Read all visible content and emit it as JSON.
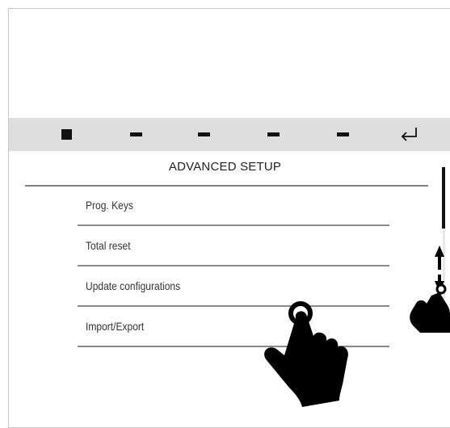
{
  "toolbar": {
    "buttons": [
      {
        "name": "stop-icon"
      },
      {
        "name": "dash-icon"
      },
      {
        "name": "dash-icon"
      },
      {
        "name": "dash-icon"
      },
      {
        "name": "dash-icon"
      },
      {
        "name": "return-arrow-icon"
      }
    ]
  },
  "screen": {
    "title": "ADVANCED SETUP",
    "menu": [
      {
        "label": "Prog. Keys"
      },
      {
        "label": "Total reset"
      },
      {
        "label": "Update configurations"
      },
      {
        "label": "Import/Export"
      }
    ]
  },
  "gestures": {
    "tap": "hand-tap-icon",
    "scroll": "hand-swipe-vertical-icon"
  },
  "colors": {
    "toolbar_bg": "#dedede",
    "text": "#333333",
    "divider": "#8a8a8a",
    "icon": "#111111"
  }
}
